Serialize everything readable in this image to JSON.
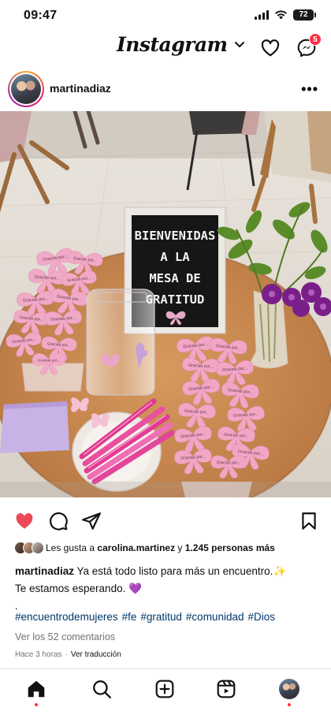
{
  "status": {
    "time": "09:47",
    "battery": "72"
  },
  "header": {
    "logo": "Instagram",
    "messages_badge": "5"
  },
  "post": {
    "username": "martinadiaz",
    "more_label": "•••",
    "sign_lines": [
      "BIENVENIDAS",
      "A LA",
      "MESA DE",
      "GRATITUD"
    ],
    "note_text": "Gracias por..."
  },
  "likes": {
    "prefix": "Les gusta a ",
    "user": "carolina.martinez",
    "conjunction": " y ",
    "others": "1.245 personas más"
  },
  "caption": {
    "username": "martinadiaz",
    "line1": " Ya está todo listo para más un encuentro.",
    "emoji1": "✨",
    "line2": "Te estamos esperando.",
    "emoji2": "💜",
    "line3": "."
  },
  "hashtags": [
    "#encuentrodemujeres",
    "#fe",
    "#gratitud",
    "#comunidad",
    "#Dios"
  ],
  "comments_link": "Ver los 52 comentarios",
  "meta": {
    "time": "Hace 3 horas",
    "separator": "·",
    "translate": "Ver traducción"
  },
  "colors": {
    "like_red": "#ed4956",
    "hashtag_blue": "#00376b",
    "badge_red": "#ff3040"
  },
  "icons": {
    "header": [
      "chevron-down-icon",
      "heart-outline-icon",
      "messenger-icon"
    ],
    "actions": [
      "heart-filled-icon",
      "comment-icon",
      "share-icon",
      "bookmark-icon"
    ],
    "nav": [
      "home-icon",
      "search-icon",
      "create-icon",
      "reels-icon",
      "profile-avatar"
    ]
  }
}
